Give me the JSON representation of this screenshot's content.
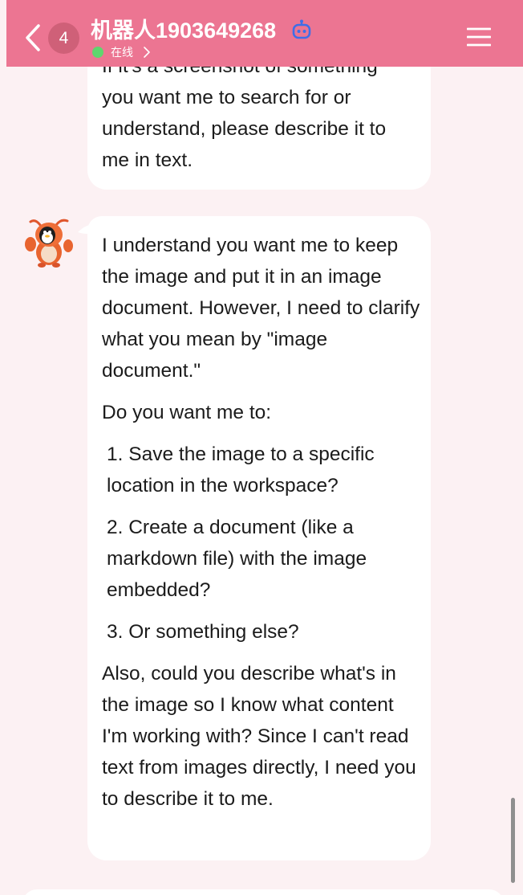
{
  "header": {
    "unread_count": "4",
    "title": "机器人1903649268",
    "status": "在线",
    "icons": [
      "back-icon",
      "robot-icon",
      "chevron-right-icon",
      "hamburger-menu-icon"
    ]
  },
  "messages": [
    {
      "sender": "bot",
      "lines": [
        "If it's a screenshot of something",
        "you want me to search for or",
        "understand, please describe it to",
        "me in text."
      ]
    },
    {
      "sender": "bot",
      "paragraphs": [
        "I understand you want me to keep the image and put it in an image document. However, I need to clarify what you mean by \"image document.\"",
        "Do you want me to:"
      ],
      "options": [
        "1. Save the image to a specific location in the workspace?",
        "2. Create a document (like a markdown file) with the image embedded?",
        "3. Or something else?"
      ],
      "closing": "Also, could you describe what's in the image so I know what content I'm working with? Since I can't read text from images directly, I need you to describe it to me."
    }
  ],
  "colors": {
    "header_bg": "#ec7592",
    "page_bg": "#fcf1f3",
    "bubble_bg": "#ffffff",
    "online_dot": "#5fd66e",
    "badge_bg": "#cf6078",
    "bot_icon": "#3f6ee8"
  }
}
